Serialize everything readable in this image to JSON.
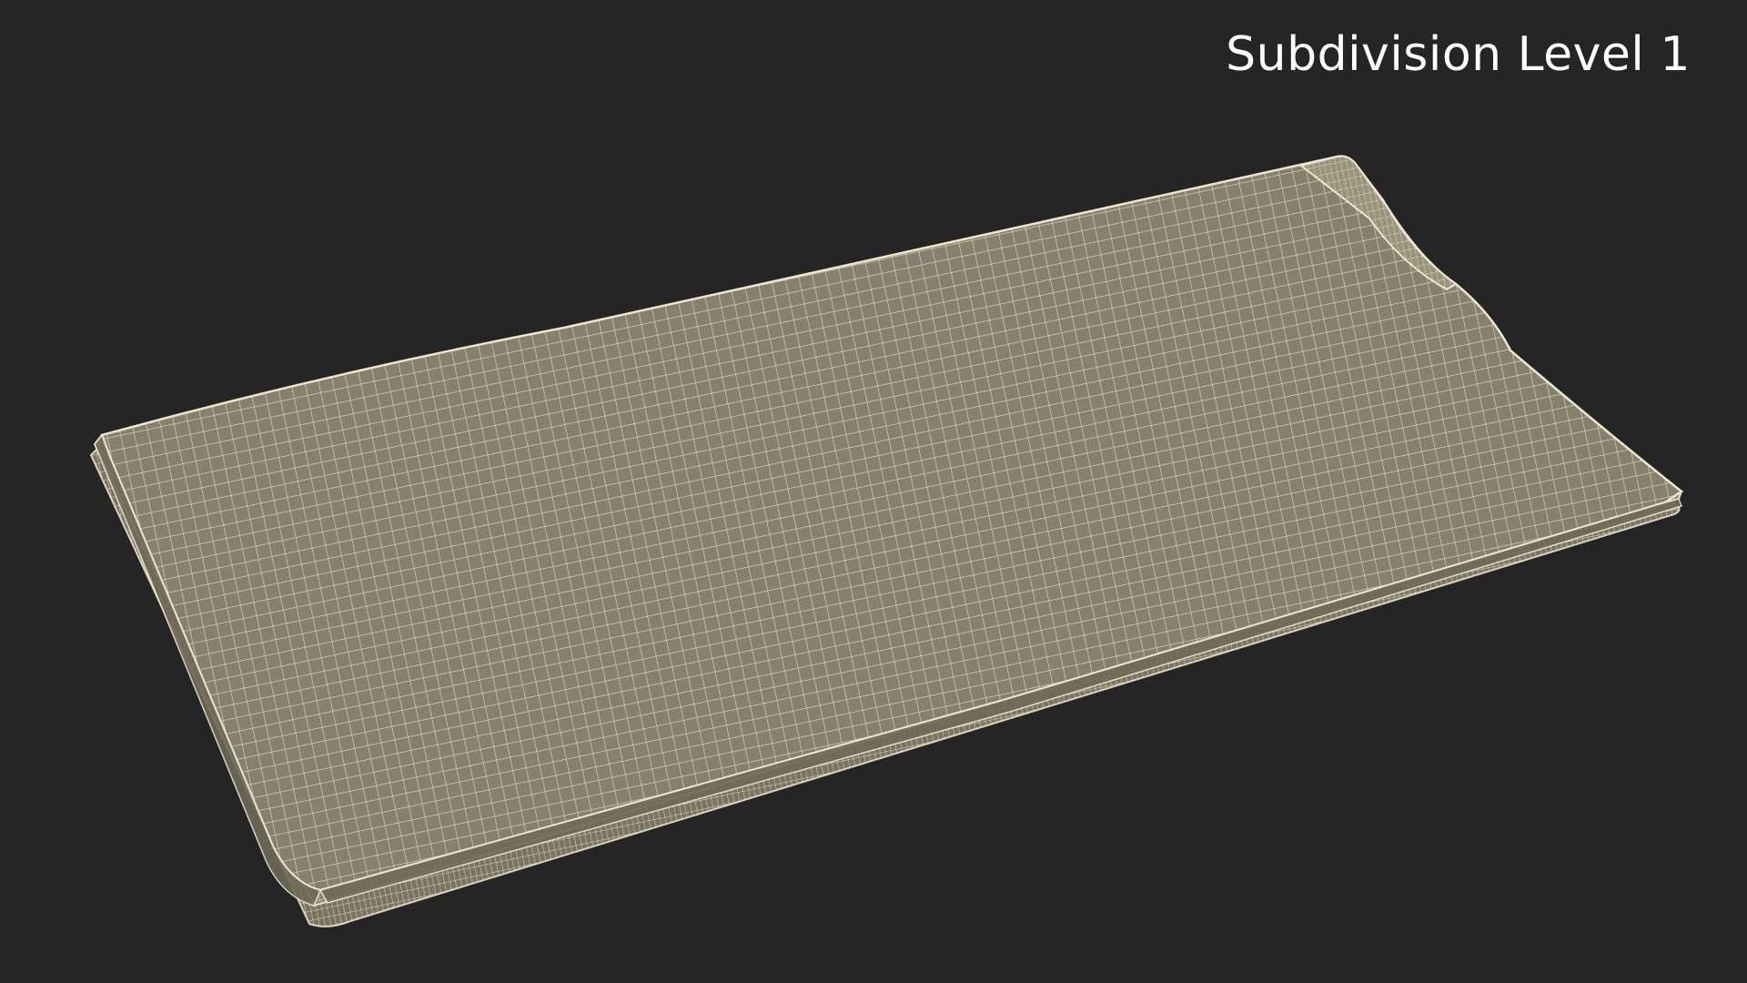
{
  "overlay": {
    "label": "Subdivision Level 1"
  },
  "scene": {
    "object": "folded cloth wireframe mesh",
    "colors": {
      "background": "#252525",
      "mesh_fill": "#86806c",
      "wire": "#ece6cf",
      "fold_shadow": "#6f6a58"
    }
  }
}
